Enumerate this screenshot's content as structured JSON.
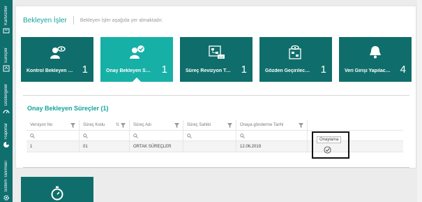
{
  "sidebar": {
    "items": [
      {
        "label": "Kartvizitler",
        "icon": "card-icon"
      },
      {
        "label": "Süreçler",
        "icon": "process-icon"
      },
      {
        "label": "Göstergeler",
        "icon": "gauge-icon"
      },
      {
        "label": "Raporlar",
        "icon": "pie-chart-icon"
      },
      {
        "label": "Sistem Tanımları",
        "icon": "gear-icon"
      }
    ]
  },
  "header": {
    "title": "Bekleyen İşler",
    "subtitle": "Bekleyen İşler aşağıda yer almaktadır."
  },
  "tiles": [
    {
      "label": "Kontrol Bekleyen Süreçler",
      "count": "1",
      "icon": "user-eye-icon",
      "active": false
    },
    {
      "label": "Onay Bekleyen Süreçler",
      "count": "1",
      "icon": "user-check-icon",
      "active": true
    },
    {
      "label": "Süreç Revizyon Talepleri",
      "count": "1",
      "icon": "flowchart-version-icon",
      "active": false
    },
    {
      "label": "Gözden Geçirilecek Süreçler",
      "count": "1",
      "icon": "flowchart-eye-icon",
      "active": false
    },
    {
      "label": "Veri Girişi Yapılacak Göstergeler",
      "count": "4",
      "icon": "bell-icon",
      "active": false
    }
  ],
  "section": {
    "title": "Onay Bekleyen Süreçler (1)"
  },
  "table": {
    "columns": [
      "Versiyon No",
      "Süreç Kodu",
      "Süreç Adı",
      "Süreç Sahibi",
      "Onaya gönderme Tarihi",
      ""
    ],
    "rows": [
      {
        "version": "1",
        "code": "01",
        "name": "ORTAK SÜREÇLER",
        "owner": "",
        "date": "12.06.2019"
      }
    ]
  },
  "tooltip": {
    "text": "Onaylama"
  },
  "colors": {
    "sidebar": "#0e6f6d",
    "tile": "#0f6e6b",
    "tile_active": "#17b0a7",
    "accent": "#14a39c"
  }
}
